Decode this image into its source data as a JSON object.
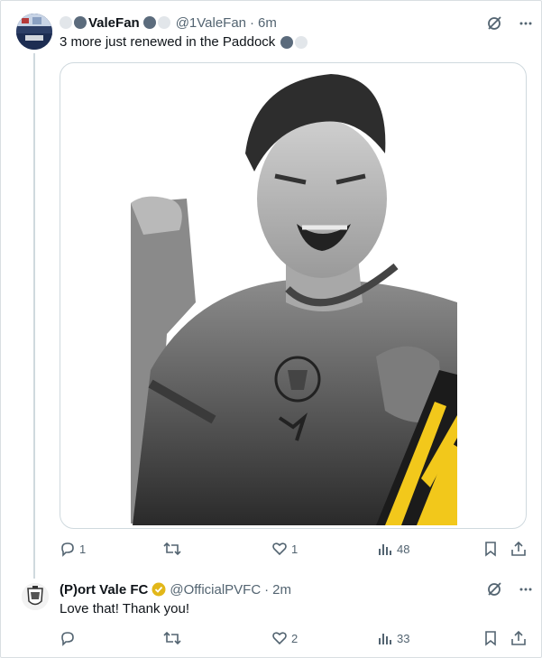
{
  "tweet1": {
    "display_name": "ValeFan",
    "handle": "@1ValeFan",
    "separator": "·",
    "time": "6m",
    "text": "3 more just renewed in the Paddock",
    "stats": {
      "replies": "1",
      "likes": "1",
      "views": "48"
    }
  },
  "tweet2": {
    "display_name": "(P)ort Vale FC",
    "handle": "@OfficialPVFC",
    "separator": "·",
    "time": "2m",
    "text": "Love that! Thank you!",
    "stats": {
      "likes": "2",
      "views": "33"
    }
  },
  "colors": {
    "text": "#0f1419",
    "muted": "#536471",
    "border": "#cfd9de",
    "verified_gold": "#e2b719",
    "kit_yellow": "#f2c81b"
  },
  "icons": [
    "grok-icon",
    "more-icon",
    "reply-icon",
    "repost-icon",
    "like-icon",
    "views-icon",
    "bookmark-icon",
    "share-icon"
  ]
}
